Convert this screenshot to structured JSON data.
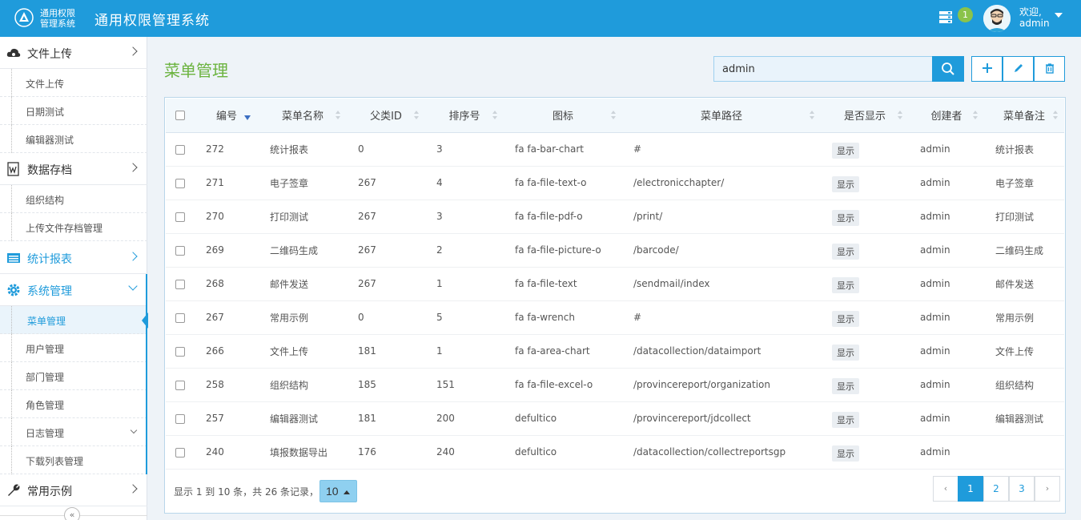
{
  "header": {
    "logo_line1": "通用权限",
    "logo_line2": "管理系统",
    "app_title": "通用权限管理系统",
    "notification_count": "1",
    "welcome_line1": "欢迎,",
    "welcome_line2": "admin",
    "brand_color": "#1f9bdb"
  },
  "sidebar": {
    "groups": [
      {
        "label": "文件上传",
        "icon": "cloud-icon",
        "items": [
          "文件上传",
          "日期测试",
          "编辑器测试"
        ]
      },
      {
        "label": "数据存档",
        "icon": "word-doc-icon",
        "items": [
          "组织结构",
          "上传文件存档管理"
        ]
      },
      {
        "label": "统计报表",
        "icon": "table-icon",
        "items": []
      },
      {
        "label": "系统管理",
        "icon": "gear-icon",
        "items": [
          "菜单管理",
          "用户管理",
          "部门管理",
          "角色管理",
          "日志管理",
          "下载列表管理"
        ],
        "active_item": "菜单管理"
      },
      {
        "label": "常用示例",
        "icon": "wrench-icon",
        "items": []
      }
    ],
    "collapse_label": "«"
  },
  "main": {
    "page_title": "菜单管理",
    "search_value": "admin",
    "columns": [
      "编号",
      "菜单名称",
      "父类ID",
      "排序号",
      "图标",
      "菜单路径",
      "是否显示",
      "创建者",
      "菜单备注"
    ],
    "rows": [
      {
        "id": "272",
        "name": "统计报表",
        "parent": "0",
        "order": "3",
        "icon": "fa fa-bar-chart",
        "path": "#",
        "show": "显示",
        "creator": "admin",
        "remark": "统计报表"
      },
      {
        "id": "271",
        "name": "电子签章",
        "parent": "267",
        "order": "4",
        "icon": "fa fa-file-text-o",
        "path": "/electronicchapter/",
        "show": "显示",
        "creator": "admin",
        "remark": "电子签章"
      },
      {
        "id": "270",
        "name": "打印测试",
        "parent": "267",
        "order": "3",
        "icon": "fa fa-file-pdf-o",
        "path": "/print/",
        "show": "显示",
        "creator": "admin",
        "remark": "打印测试"
      },
      {
        "id": "269",
        "name": "二维码生成",
        "parent": "267",
        "order": "2",
        "icon": "fa fa-file-picture-o",
        "path": "/barcode/",
        "show": "显示",
        "creator": "admin",
        "remark": "二维码生成"
      },
      {
        "id": "268",
        "name": "邮件发送",
        "parent": "267",
        "order": "1",
        "icon": "fa fa-file-text",
        "path": "/sendmail/index",
        "show": "显示",
        "creator": "admin",
        "remark": "邮件发送"
      },
      {
        "id": "267",
        "name": "常用示例",
        "parent": "0",
        "order": "5",
        "icon": "fa fa-wrench",
        "path": "#",
        "show": "显示",
        "creator": "admin",
        "remark": "常用示例"
      },
      {
        "id": "266",
        "name": "文件上传",
        "parent": "181",
        "order": "1",
        "icon": "fa fa-area-chart",
        "path": "/datacollection/dataimport",
        "show": "显示",
        "creator": "admin",
        "remark": "文件上传"
      },
      {
        "id": "258",
        "name": "组织结构",
        "parent": "185",
        "order": "151",
        "icon": "fa fa-file-excel-o",
        "path": "/provincereport/organization",
        "show": "显示",
        "creator": "admin",
        "remark": "组织结构"
      },
      {
        "id": "257",
        "name": "编辑器测试",
        "parent": "181",
        "order": "200",
        "icon": "defultico",
        "path": "/provincereport/jdcollect",
        "show": "显示",
        "creator": "admin",
        "remark": "编辑器测试"
      },
      {
        "id": "240",
        "name": "填报数据导出",
        "parent": "176",
        "order": "240",
        "icon": "defultico",
        "path": "/datacollection/collectreportsgp",
        "show": "显示",
        "creator": "admin",
        "remark": ""
      }
    ],
    "pager_info": "显示 1 到 10 条，共 26 条记录，",
    "page_size": "10",
    "pages": [
      "‹",
      "1",
      "2",
      "3",
      "›"
    ],
    "current_page": "1"
  }
}
